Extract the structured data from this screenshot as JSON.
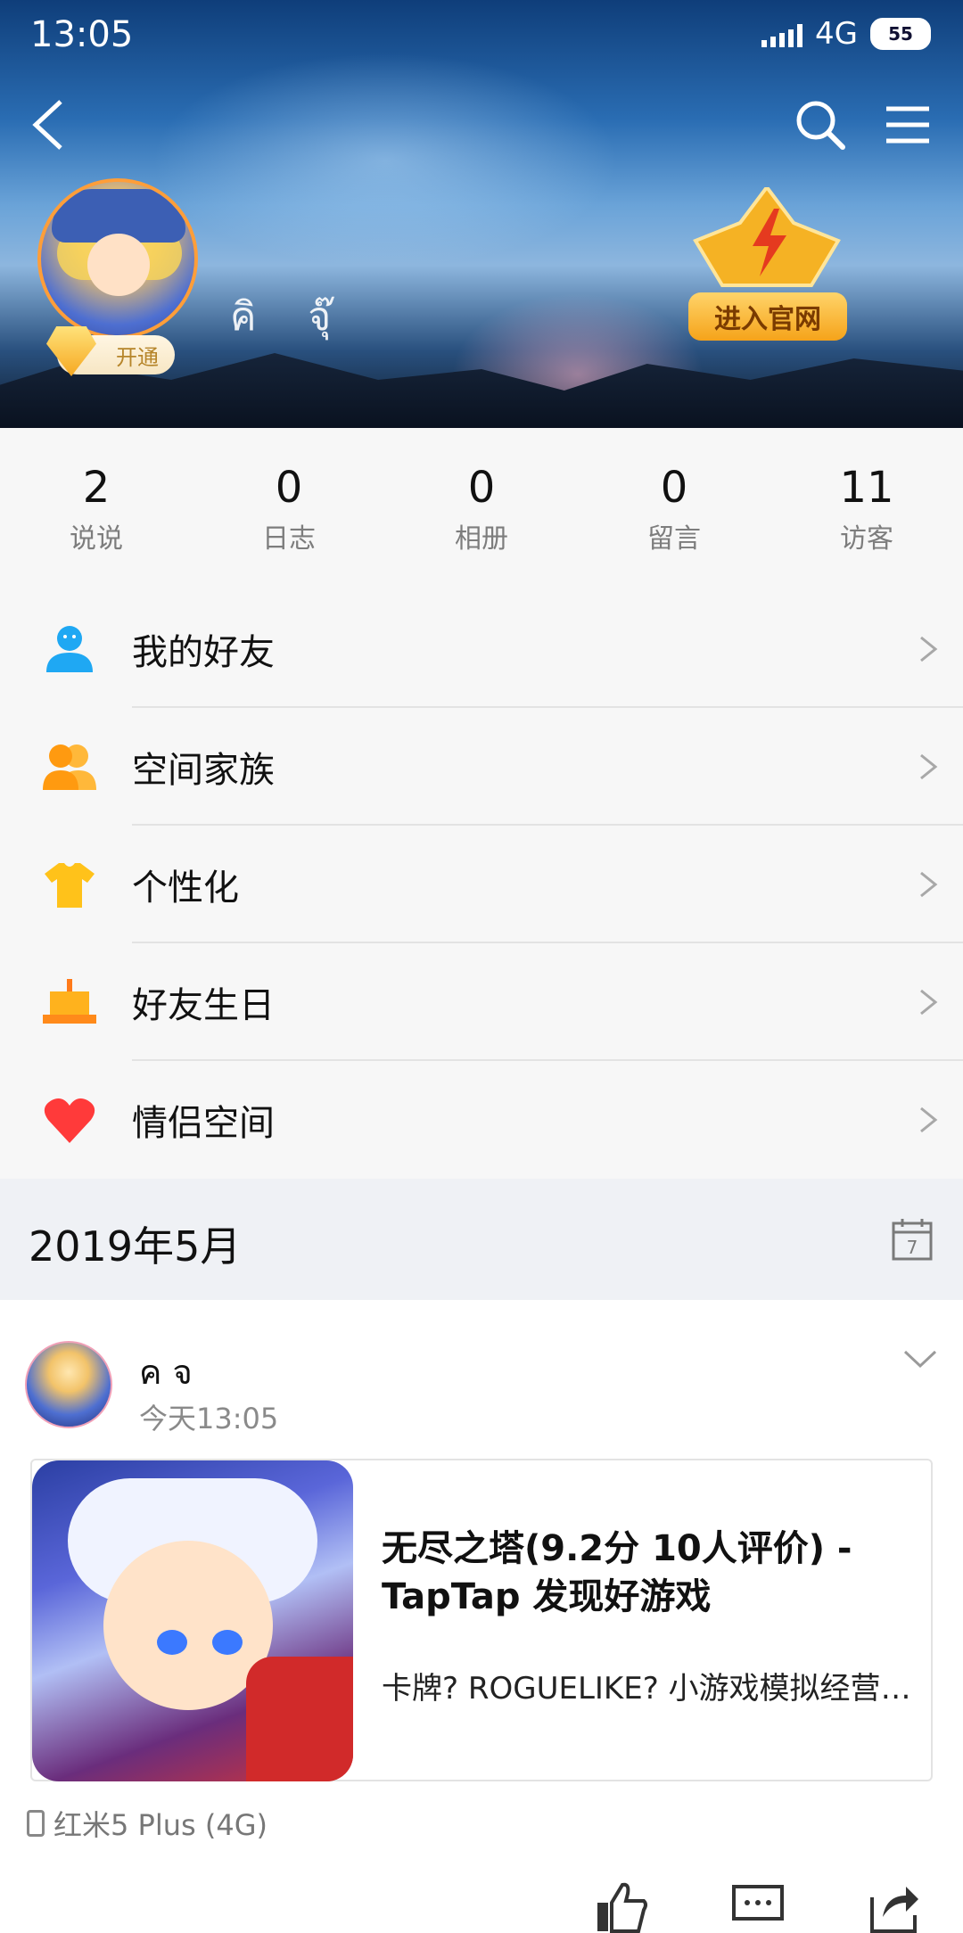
{
  "status_bar": {
    "time": "13:05",
    "network": "4G",
    "battery": "55"
  },
  "header": {
    "nickname": "คิ จุ๊",
    "vip_label": "开通",
    "official_label": "进入官网"
  },
  "stats": [
    {
      "value": "2",
      "label": "说说"
    },
    {
      "value": "0",
      "label": "日志"
    },
    {
      "value": "0",
      "label": "相册"
    },
    {
      "value": "0",
      "label": "留言"
    },
    {
      "value": "11",
      "label": "访客"
    }
  ],
  "menu": [
    {
      "label": "我的好友",
      "icon": "friend-icon",
      "color": "#1fa8f3"
    },
    {
      "label": "空间家族",
      "icon": "family-icon",
      "color": "#ffa320"
    },
    {
      "label": "个性化",
      "icon": "tshirt-icon",
      "color": "#ffc21a"
    },
    {
      "label": "好友生日",
      "icon": "cake-icon",
      "color": "#ffb21d"
    },
    {
      "label": "情侣空间",
      "icon": "heart-icon",
      "color": "#ff3a3a"
    }
  ],
  "timeline": {
    "month": "2019年5月"
  },
  "post": {
    "author": "ค จ",
    "time": "今天13:05",
    "share_title": "无尽之塔(9.2分 10人评价) - TapTap 发现好游戏",
    "share_desc": "卡牌? ROGUELIKE? 小游戏模拟经营养成",
    "device": "红米5 Plus (4G)"
  }
}
